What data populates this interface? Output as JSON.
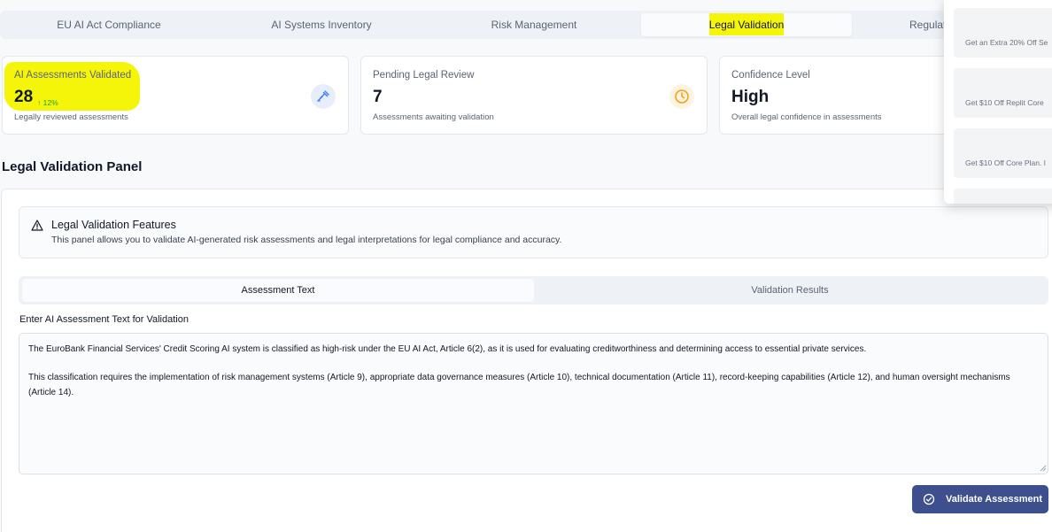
{
  "tabs": [
    {
      "label": "EU AI Act Compliance",
      "active": false
    },
    {
      "label": "AI Systems Inventory",
      "active": false
    },
    {
      "label": "Risk Management",
      "active": false
    },
    {
      "label": "Legal Validation",
      "active": true
    },
    {
      "label": "Regulati",
      "active": false
    }
  ],
  "stats": [
    {
      "label": "AI Assessments Validated",
      "value": "28",
      "trend": "↑ 12%",
      "sub": "Legally reviewed assessments",
      "icon": "gavel-icon"
    },
    {
      "label": "Pending Legal Review",
      "value": "7",
      "sub": "Assessments awaiting validation",
      "icon": "clock-icon"
    },
    {
      "label": "Confidence Level",
      "value": "High",
      "sub": "Overall legal confidence in assessments"
    }
  ],
  "panel": {
    "title": "Legal Validation Panel",
    "alert": {
      "title": "Legal Validation Features",
      "description": "This panel allows you to validate AI-generated risk assessments and legal interpretations for legal compliance and accuracy.",
      "icon": "warning-triangle-icon"
    },
    "subtabs": [
      "Assessment Text",
      "Validation Results"
    ],
    "field_label": "Enter AI Assessment Text for Validation",
    "assessment_text": [
      "The EuroBank Financial Services' Credit Scoring AI system is classified as high-risk under the EU AI Act, Article 6(2), as it is used for evaluating creditworthiness and determining access to essential private services.",
      "This classification requires the implementation of risk management systems (Article 9), appropriate data governance measures (Article 10), technical documentation (Article 11), record-keeping capabilities (Article 12), and human oversight mechanisms (Article 14)."
    ],
    "button_label": "Validate Assessment"
  },
  "popup": {
    "promos": [
      "Get an Extra 20% Off Se",
      "Get $10 Off Replit Core",
      "Get $10 Off Core Plan. I"
    ]
  },
  "colors": {
    "accent": "#3d4f8c",
    "highlight": "#f5f50a",
    "trend": "#16a34a",
    "gavel": "#3b82f6",
    "clock": "#f59e0b"
  }
}
